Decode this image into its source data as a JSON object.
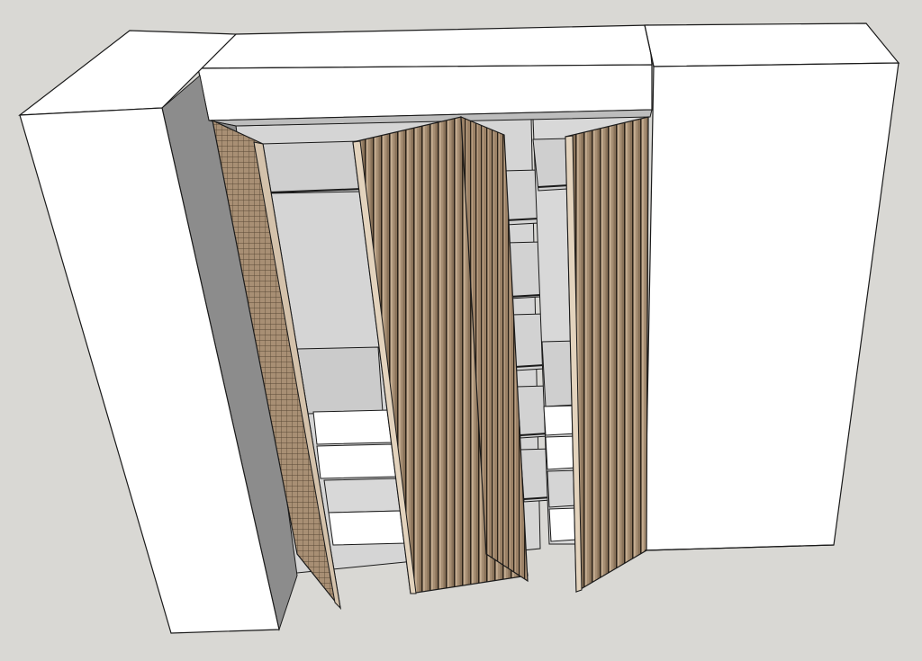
{
  "scene": {
    "subject": "wardrobe",
    "view": "3d-model",
    "colors": {
      "background": "#d9d8d4",
      "carcass_face": "#ffffff",
      "carcass_side_light": "#cfcfcf",
      "carcass_side_dark": "#8c8c8c",
      "interior": "#d6d6d6",
      "slat_wood": "#a68e73",
      "slat_shadow": "#6f5c47",
      "edge_line": "#1a1a1a"
    }
  }
}
